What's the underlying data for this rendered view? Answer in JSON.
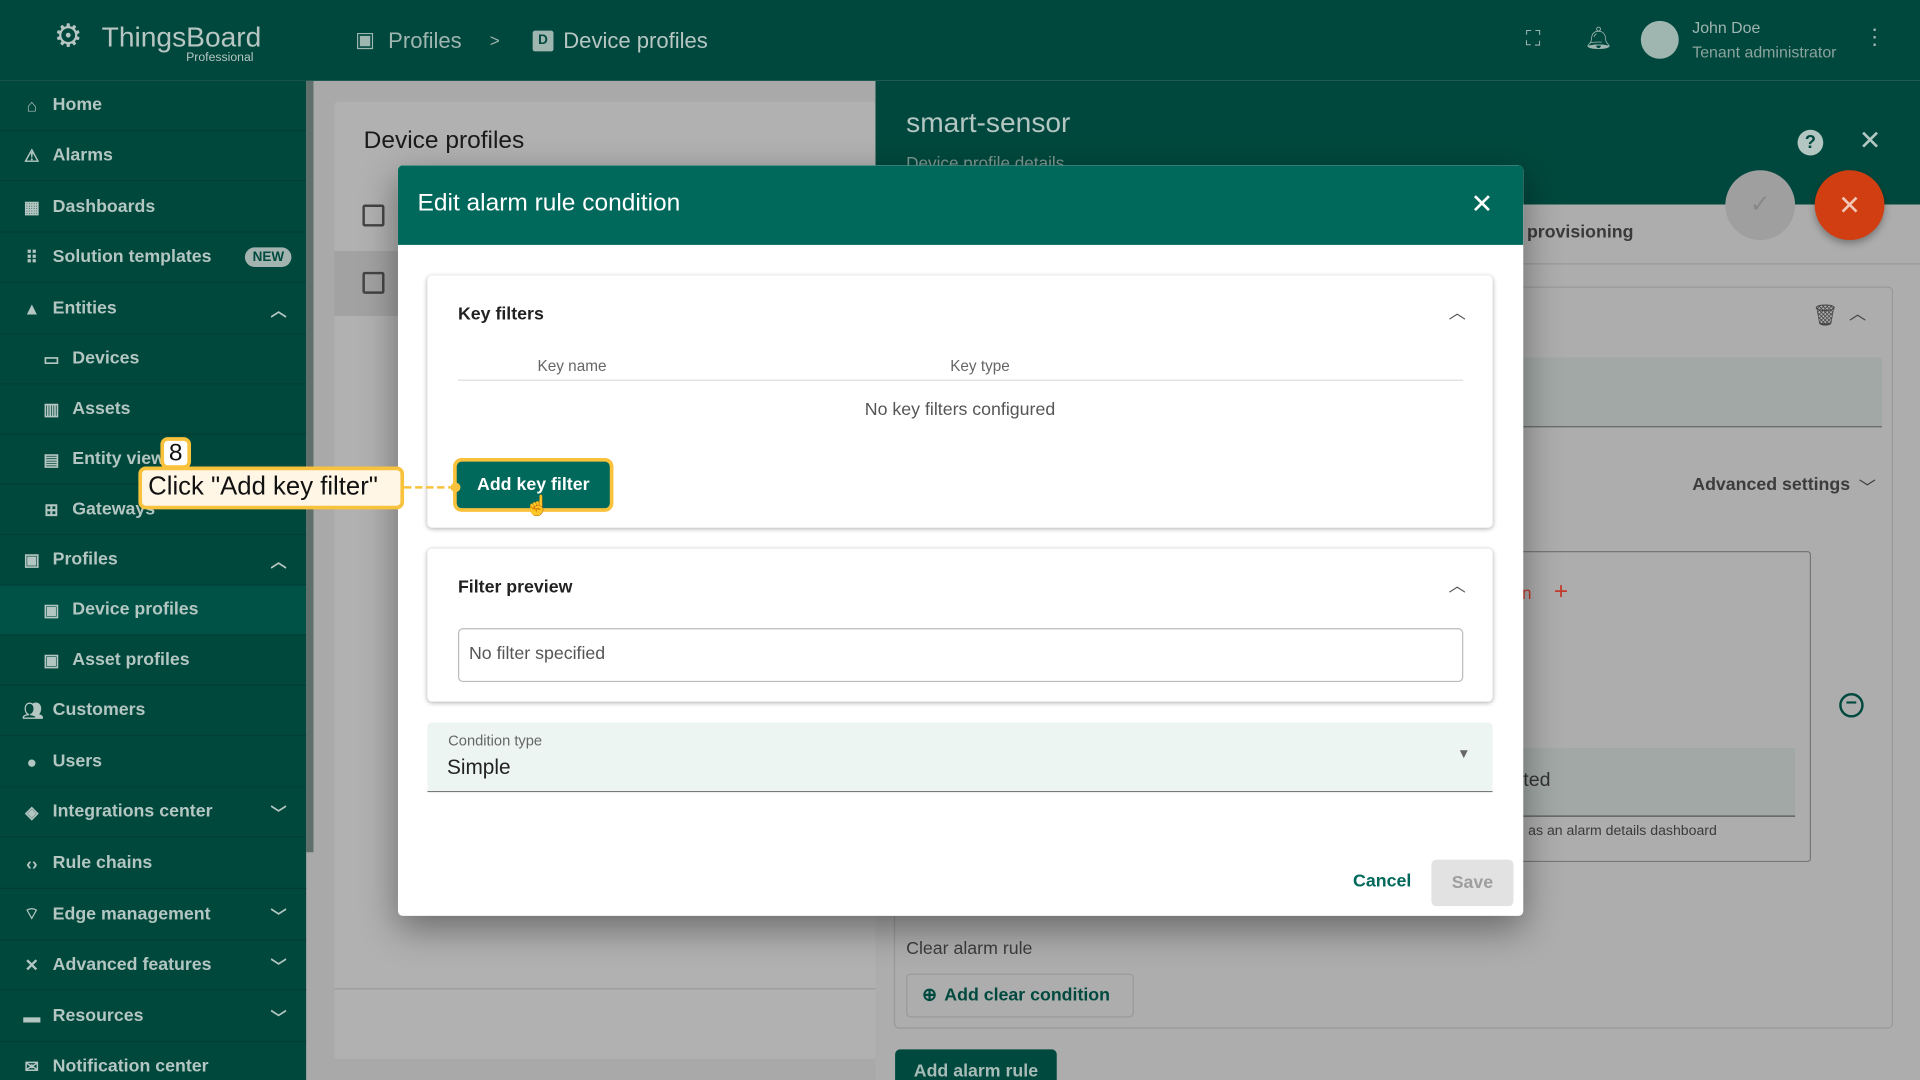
{
  "app": {
    "name": "ThingsBoard",
    "edition": "Professional"
  },
  "breadcrumb": [
    {
      "label": "Profiles",
      "icon": "profiles-icon"
    },
    {
      "separator": ">"
    },
    {
      "label": "Device profiles",
      "icon": "device-profile-icon"
    }
  ],
  "user": {
    "name": "John Doe",
    "role": "Tenant administrator"
  },
  "sidebar": {
    "items": [
      {
        "label": "Home"
      },
      {
        "label": "Alarms"
      },
      {
        "label": "Dashboards"
      },
      {
        "label": "Solution templates",
        "badge": "NEW"
      },
      {
        "label": "Entities"
      },
      {
        "label": "Devices"
      },
      {
        "label": "Assets"
      },
      {
        "label": "Entity views"
      },
      {
        "label": "Gateways"
      },
      {
        "label": "Profiles"
      },
      {
        "label": "Device profiles"
      },
      {
        "label": "Asset profiles"
      },
      {
        "label": "Customers"
      },
      {
        "label": "Users"
      },
      {
        "label": "Integrations center"
      },
      {
        "label": "Rule chains"
      },
      {
        "label": "Edge management"
      },
      {
        "label": "Advanced features"
      },
      {
        "label": "Resources"
      },
      {
        "label": "Notification center"
      }
    ]
  },
  "list": {
    "title": "Device profiles"
  },
  "details": {
    "title": "smart-sensor",
    "subtitle": "Device profile details",
    "tab_partial": "provisioning",
    "advanced_settings": "Advanced settings",
    "partial_text_1": "n",
    "partial_text_2": "ted",
    "dashboard_hint": "as an alarm details dashboard",
    "clear_alarm_rule": "Clear alarm rule",
    "add_clear_condition": "Add clear condition",
    "add_alarm_rule": "Add alarm rule"
  },
  "dialog": {
    "title": "Edit alarm rule condition",
    "key_filters": {
      "title": "Key filters",
      "columns": [
        "Key name",
        "Key type"
      ],
      "empty": "No key filters configured",
      "add_button": "Add key filter"
    },
    "filter_preview": {
      "title": "Filter preview",
      "value": "No filter specified"
    },
    "condition_type": {
      "label": "Condition type",
      "value": "Simple"
    },
    "cancel": "Cancel",
    "save": "Save"
  },
  "annotation": {
    "step": "8",
    "text": "Click \"Add key filter\""
  },
  "colors": {
    "primary": "#00695c",
    "header": "#00483d",
    "accent": "#d84315",
    "highlight": "#f9c23c"
  }
}
